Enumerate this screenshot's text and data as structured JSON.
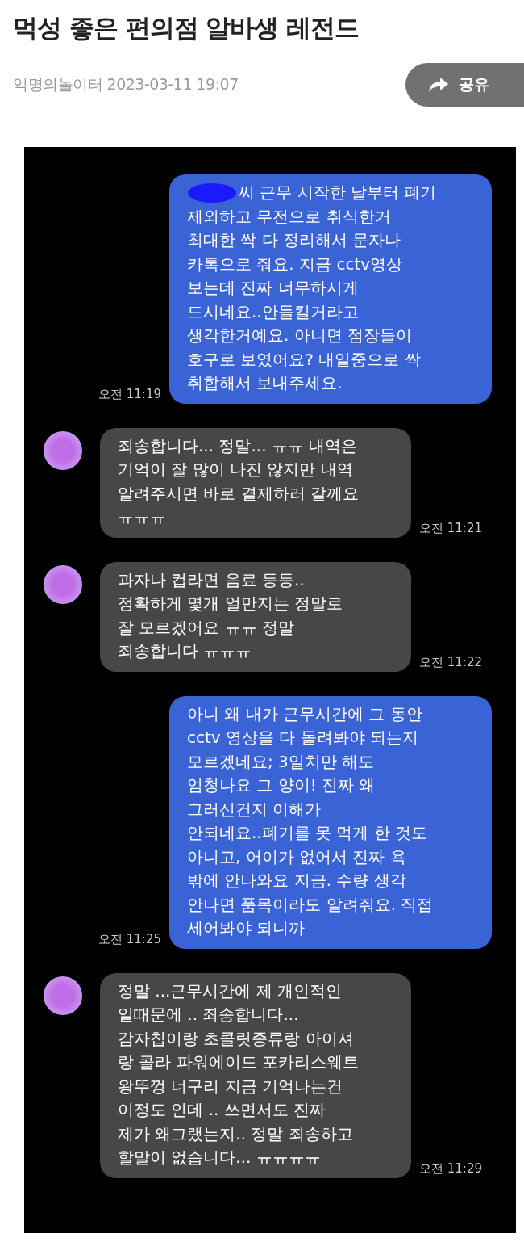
{
  "post": {
    "title": "먹성 좋은 편의점 알바생 레전드",
    "author": "익명의놀이터",
    "date": "2023-03-11 19:07",
    "share_button": "공유"
  },
  "chat": {
    "messages": [
      {
        "kind": "sent",
        "redacted": true,
        "text": "씨 근무 시작한 날부터 폐기\n제외하고 무전으로 취식한거\n최대한 싹 다 정리해서 문자나\n카톡으로 줘요. 지금 cctv영상\n보는데 진짜 너무하시게\n드시네요..안들킬거라고\n생각한거예요. 아니면 점장들이\n호구로 보였어요? 내일중으로 싹\n취합해서 보내주세요.",
        "time": "오전 11:19"
      },
      {
        "kind": "received",
        "redacted": false,
        "text": "죄송합니다... 정말... ㅠㅠ 내역은\n기억이 잘 많이 나진 않지만 내역\n알려주시면 바로 결제하러 갈께요\nㅠㅠㅠ",
        "time": "오전 11:21"
      },
      {
        "kind": "received",
        "redacted": false,
        "text": "과자나 컵라면 음료 등등..\n정확하게 몇개 얼만지는 정말로\n잘 모르겠어요 ㅠㅠ 정말\n죄송합니다 ㅠㅠㅠ",
        "time": "오전 11:22"
      },
      {
        "kind": "sent",
        "redacted": false,
        "text": "아니 왜 내가 근무시간에 그 동안\ncctv 영상을 다 돌려봐야 되는지\n모르겠네요; 3일치만 해도\n엄청나요 그 양이! 진짜 왜\n그러신건지 이해가\n안되네요..폐기를 못 먹게 한 것도\n아니고, 어이가 없어서 진짜 욕\n밖에 안나와요 지금. 수량 생각\n안나면 품목이라도 알려줘요. 직접\n세어봐야 되니까",
        "time": "오전 11:25"
      },
      {
        "kind": "received",
        "redacted": false,
        "text": "정말 ...근무시간에 제 개인적인\n일때문에 .. 죄송합니다...\n감자칩이랑 초콜릿종류랑 아이셔\n랑 콜라 파워에이드 포카리스웨트\n왕뚜껑 너구리 지금 기억나는건\n이정도 인데 .. 쓰면서도 진짜\n제가 왜그랬는지.. 정말 죄송하고\n할말이 없습니다... ㅠㅠㅠㅠ",
        "time": "오전 11:29"
      }
    ]
  }
}
